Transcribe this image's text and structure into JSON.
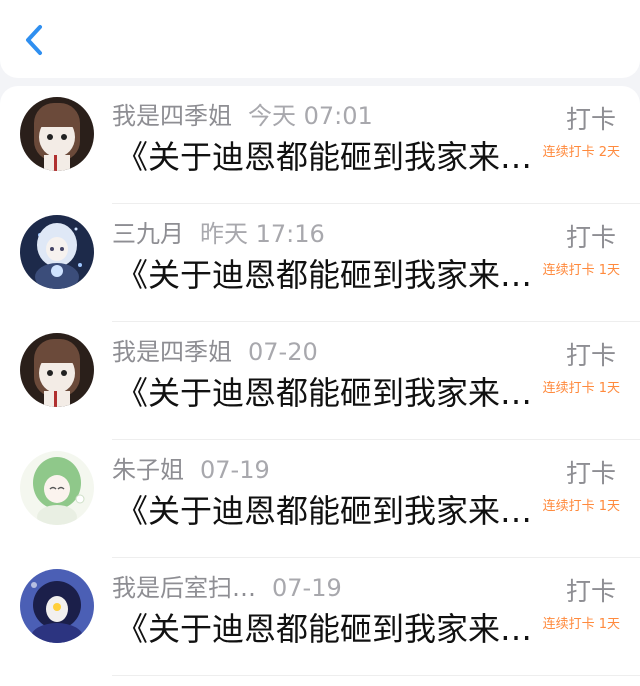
{
  "colors": {
    "accent": "#2f8ff0",
    "streak": "#ff8a3d",
    "meta": "#8e8e93",
    "title": "#111111"
  },
  "header": {
    "back_icon": "chevron-left-icon"
  },
  "rows": [
    {
      "name": "我是四季姐",
      "time": "今天 07:01",
      "title": "《关于迪恩都能砸到我家来…",
      "action": "打卡",
      "streak": "连续打卡 2天"
    },
    {
      "name": "三九月",
      "time": "昨天 17:16",
      "title": "《关于迪恩都能砸到我家来…",
      "action": "打卡",
      "streak": "连续打卡 1天"
    },
    {
      "name": "我是四季姐",
      "time": "07-20",
      "title": "《关于迪恩都能砸到我家来…",
      "action": "打卡",
      "streak": "连续打卡 1天"
    },
    {
      "name": "朱子姐",
      "time": "07-19",
      "title": "《关于迪恩都能砸到我家来…",
      "action": "打卡",
      "streak": "连续打卡 1天"
    },
    {
      "name": "我是后室扫…",
      "time": "07-19",
      "title": "《关于迪恩都能砸到我家来…",
      "action": "打卡",
      "streak": "连续打卡 1天"
    }
  ]
}
